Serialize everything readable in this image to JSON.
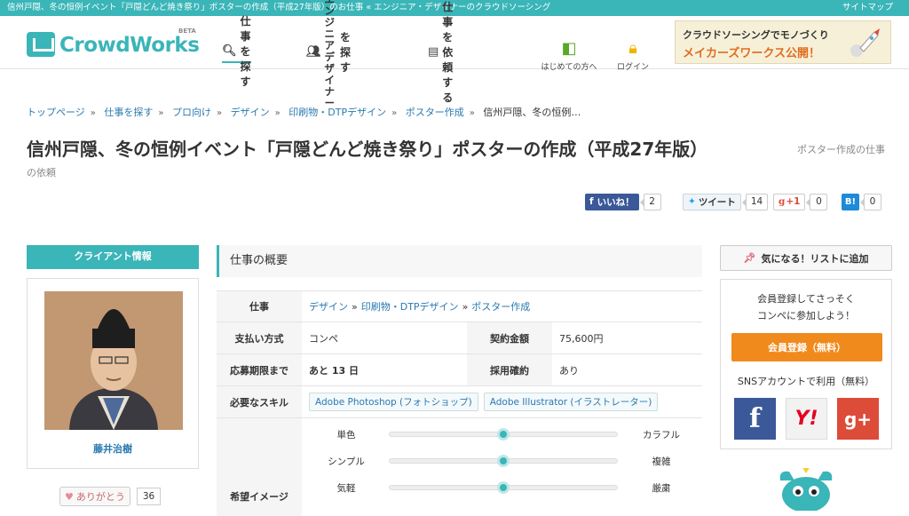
{
  "topbar": {
    "title": "信州戸隠、冬の恒例イベント「戸隠どんど焼き祭り」ポスターの作成（平成27年版）のお仕事 « エンジニア・デザイナーのクラウドソーシング",
    "sitemap": "サイトマップ"
  },
  "header": {
    "logo_text": "CrowdWorks",
    "logo_beta": "BETA",
    "nav": {
      "find_job": "仕事を探す",
      "find_engineer_line1": "エンジニア",
      "find_engineer_line2": "デザイナー",
      "find_engineer_suffix": "を探す",
      "request_job": "仕事を依頼する",
      "beginners": "はじめての方へ",
      "login": "ログイン"
    },
    "banner": {
      "line1": "クラウドソーシングでモノづくり",
      "line2": "メイカーズワークス公開！"
    }
  },
  "breadcrumb": {
    "items": [
      "トップページ",
      "仕事を探す",
      "プロ向け",
      "デザイン",
      "印刷物・DTPデザイン",
      "ポスター作成"
    ],
    "current": "信州戸隠、冬の恒例…"
  },
  "page": {
    "title": "信州戸隠、冬の恒例イベント「戸隠どんど焼き祭り」ポスターの作成（平成27年版）",
    "subtitle_part1": "ポスター作成の仕事",
    "subtitle_part2": "の依頼"
  },
  "share": {
    "facebook_label": "いいね！",
    "facebook_count": "2",
    "twitter_label": "ツイート",
    "twitter_count": "14",
    "gplus_label": "+1",
    "gplus_count": "0",
    "hatena_label": "B!",
    "hatena_count": "0"
  },
  "client": {
    "header": "クライアント情報",
    "name": "藤井治樹",
    "thanks_label": "ありがとう",
    "thanks_count": "36"
  },
  "overview": {
    "header": "仕事の概要",
    "job_label": "仕事",
    "job_path": [
      "デザイン",
      "印刷物・DTPデザイン",
      "ポスター作成"
    ],
    "payment_label": "支払い方式",
    "payment_value": "コンペ",
    "amount_label": "契約金額",
    "amount_value": "75,600円",
    "deadline_label": "応募期限まで",
    "deadline_value": "あと 13 日",
    "confirmed_label": "採用確約",
    "confirmed_value": "あり",
    "skills_label": "必要なスキル",
    "skills": [
      "Adobe Photoshop (フォトショップ)",
      "Adobe Illustrator (イラストレーター)"
    ],
    "image_label": "希望イメージ",
    "sliders": [
      {
        "left": "単色",
        "right": "カラフル",
        "level": 0.5
      },
      {
        "left": "シンプル",
        "right": "複雑",
        "level": 0.5
      },
      {
        "left": "気軽",
        "right": "厳粛",
        "level": 0.5
      }
    ]
  },
  "sidebar": {
    "favorite_button": "気になる！リストに追加",
    "register_msg_line1": "会員登録してさっそく",
    "register_msg_line2": "コンペに参加しよう！",
    "register_button": "会員登録（無料）",
    "sns_label": "SNSアカウントで利用（無料）",
    "sns_facebook": "f",
    "sns_yahoo": "Y!",
    "sns_google": "g+"
  },
  "colors": {
    "brand": "#3ab5b8",
    "link": "#2a7ab0",
    "register": "#f08a1c"
  }
}
